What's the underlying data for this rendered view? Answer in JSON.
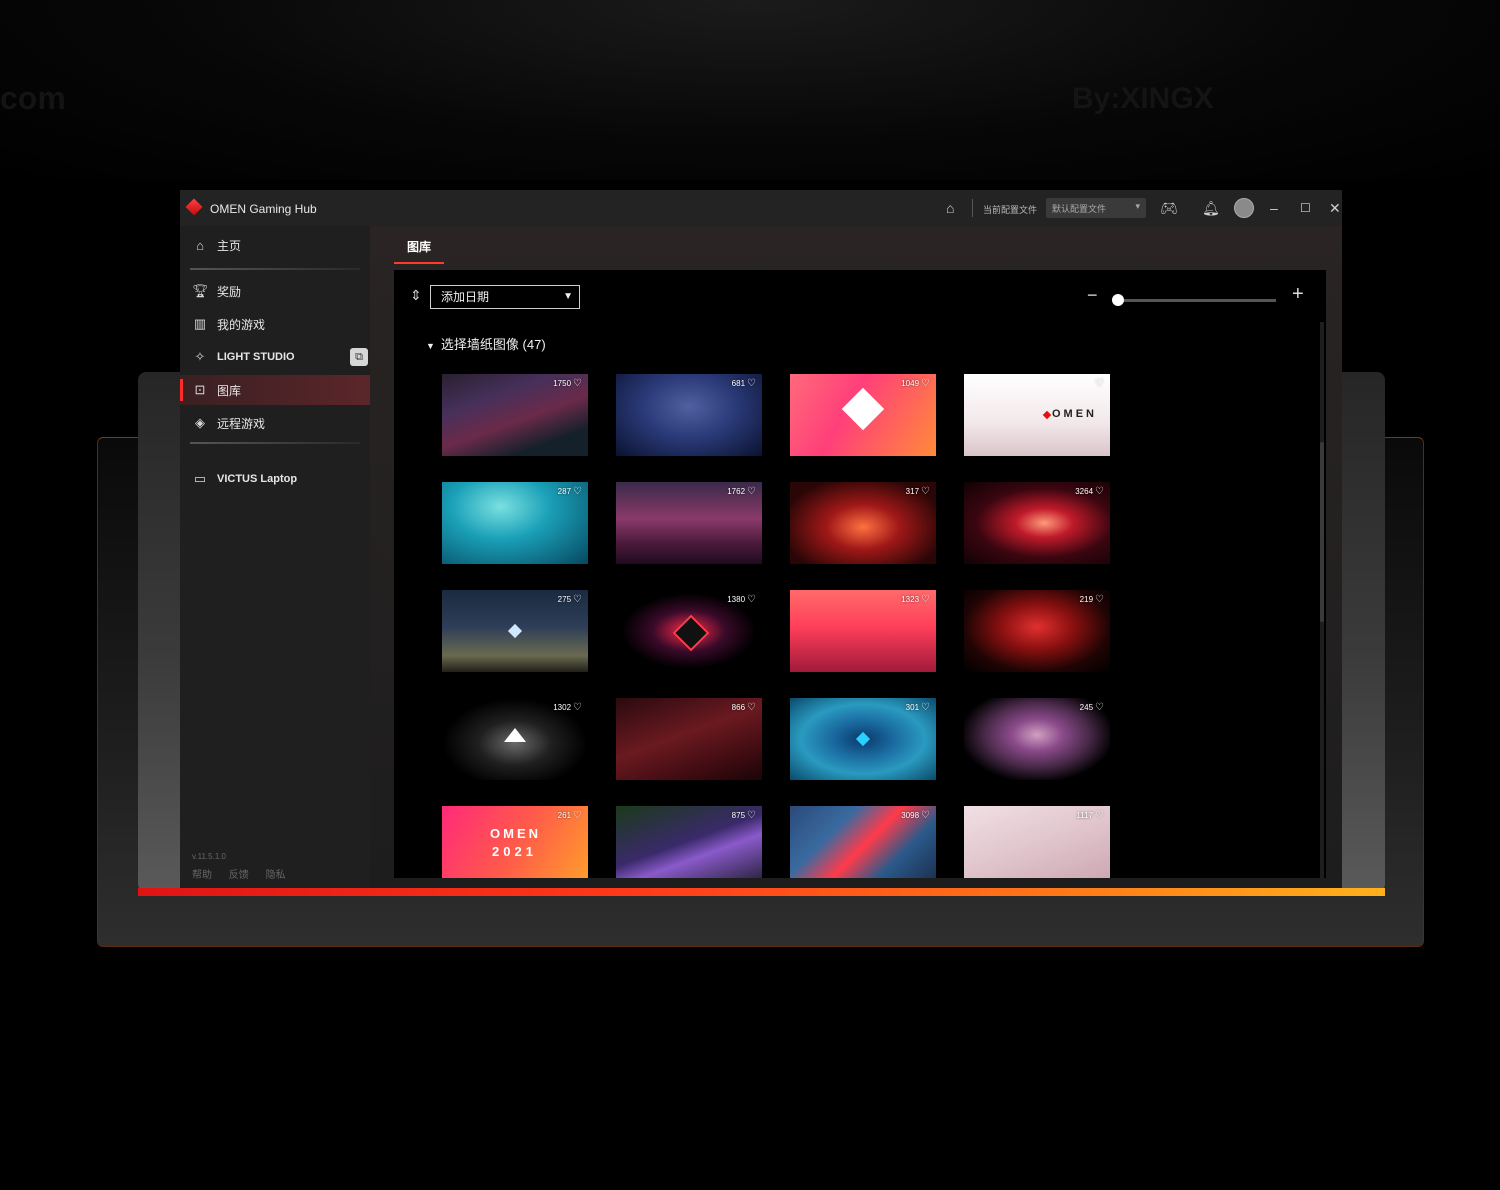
{
  "watermarks": {
    "left": "com",
    "right": "By:XINGX"
  },
  "app": {
    "title": "OMEN Gaming Hub"
  },
  "titlebar": {
    "profile_label": "当前配置文件",
    "profile_select": "默认配置文件"
  },
  "sidebar": {
    "items": [
      {
        "label": "主页",
        "icon": "home-icon"
      },
      {
        "label": "奖励",
        "icon": "trophy-icon"
      },
      {
        "label": "我的游戏",
        "icon": "library-icon"
      },
      {
        "label": "LIGHT STUDIO",
        "icon": "light-studio-icon"
      },
      {
        "label": "图库",
        "icon": "gallery-icon"
      },
      {
        "label": "远程游戏",
        "icon": "remote-play-icon"
      },
      {
        "label": "VICTUS Laptop",
        "icon": "laptop-icon"
      }
    ],
    "version": "v.11.5.1.0",
    "footer": [
      "帮助",
      "反馈",
      "隐私"
    ]
  },
  "content": {
    "tab": "图库",
    "date_select": "添加日期",
    "section_title": "选择墙纸图像 (47)",
    "zoom_level": 0
  },
  "gallery": [
    {
      "likes": "1750"
    },
    {
      "likes": "681"
    },
    {
      "likes": "1049"
    },
    {
      "likes": ""
    },
    {
      "likes": "287"
    },
    {
      "likes": "1762"
    },
    {
      "likes": "317"
    },
    {
      "likes": "3264"
    },
    {
      "likes": "275"
    },
    {
      "likes": "1380"
    },
    {
      "likes": "1323"
    },
    {
      "likes": "219"
    },
    {
      "likes": "1302"
    },
    {
      "likes": "866"
    },
    {
      "likes": "301"
    },
    {
      "likes": "245"
    },
    {
      "likes": "261"
    },
    {
      "likes": "875"
    },
    {
      "likes": "3098"
    },
    {
      "likes": "1117"
    }
  ],
  "tile_text": {
    "omen_logo": "OMEN",
    "omen_2021_a": "OMEN",
    "omen_2021_b": "2021"
  },
  "colors": {
    "accent": "#ff2a2a",
    "accent_orange": "#ffb21c",
    "window_bg": "#1c1c1c"
  }
}
